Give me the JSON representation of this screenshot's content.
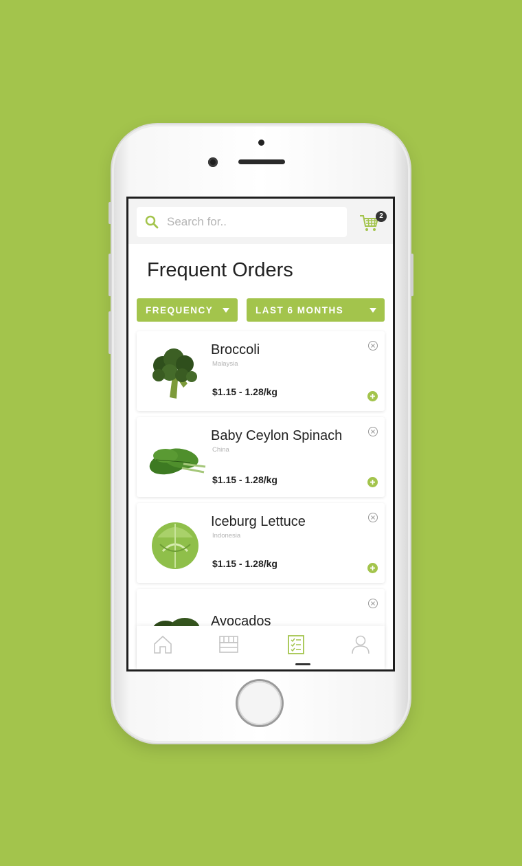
{
  "colors": {
    "background": "#a3c44c",
    "accent": "#a3c44c",
    "text": "#222222",
    "muted": "#b3b3b3"
  },
  "search": {
    "placeholder": "Search for.."
  },
  "cart": {
    "icon": "cart-icon",
    "badge_count": "2"
  },
  "page": {
    "title": "Frequent Orders"
  },
  "filters": [
    {
      "label": "FREQUENCY",
      "icon": "caret-down-icon"
    },
    {
      "label": "LAST 6 MONTHS",
      "icon": "caret-down-icon"
    }
  ],
  "products": [
    {
      "name": "Broccoli",
      "origin": "Malaysia",
      "price": "$1.15 - 1.28/kg",
      "image": "broccoli-image"
    },
    {
      "name": "Baby Ceylon Spinach",
      "origin": "China",
      "price": "$1.15 - 1.28/kg",
      "image": "spinach-image"
    },
    {
      "name": "Iceburg Lettuce",
      "origin": "Indonesia",
      "price": "$1.15 - 1.28/kg",
      "image": "lettuce-image"
    },
    {
      "name": "Avocados",
      "origin": "",
      "price": "",
      "image": "avocado-image"
    }
  ],
  "bottom_nav": [
    {
      "name": "home",
      "icon": "home-icon",
      "active": false
    },
    {
      "name": "store",
      "icon": "store-icon",
      "active": false
    },
    {
      "name": "orders",
      "icon": "checklist-icon",
      "active": true
    },
    {
      "name": "profile",
      "icon": "user-icon",
      "active": false
    }
  ]
}
